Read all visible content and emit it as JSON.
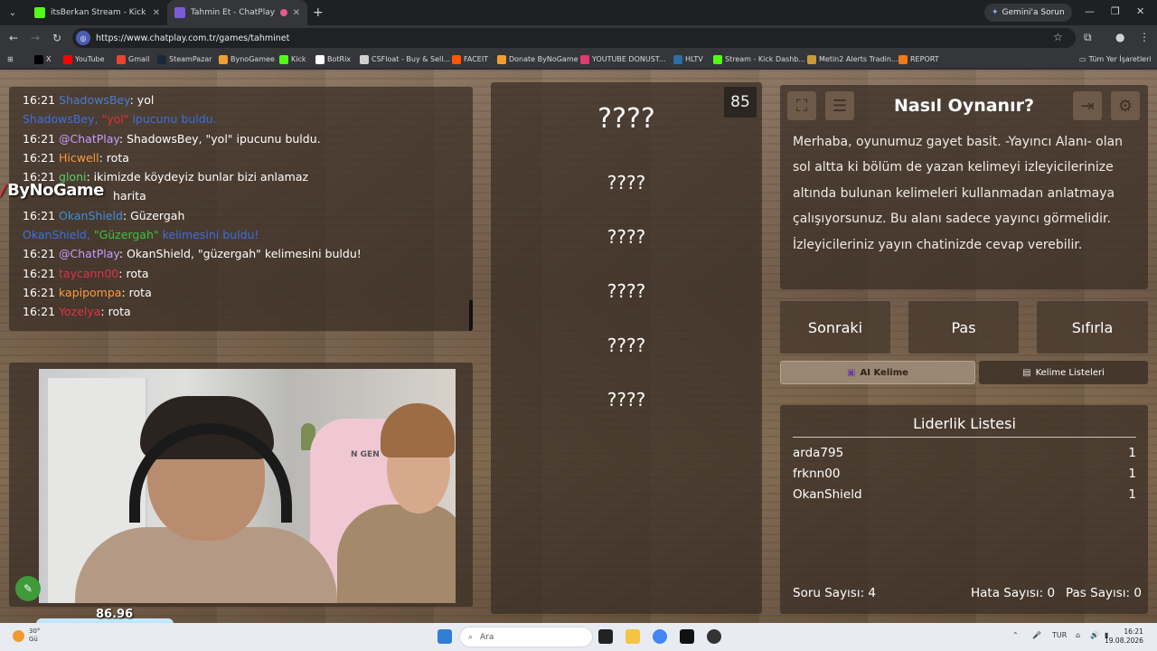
{
  "browser": {
    "tabs": [
      {
        "title": "itsBerkan Stream - Kick Dashbo",
        "favicon_color": "#53fc18"
      },
      {
        "title": "Tahmin Et - ChatPlay",
        "favicon_color": "#7b5cd6"
      }
    ],
    "gemini_label": "Gemini'a Sorun",
    "url": "https://www.chatplay.com.tr/games/tahminet",
    "bookmarks": [
      "X",
      "YouTube",
      "Gmail",
      "SteamPazar",
      "BynoGamee",
      "Kick",
      "BotRix",
      "CSFloat - Buy & Sell...",
      "FACEIT",
      "Donate ByNoGame",
      "YOUTUBE DONUST...",
      "HLTV",
      "Stream - Kick Dashb...",
      "Metin2 Alerts Tradin...",
      "REPORT"
    ],
    "all_bookmarks": "Tüm Yer İşaretleri"
  },
  "chat": {
    "messages": [
      {
        "time": "16:21",
        "user": "ShadowsBey",
        "user_color": "#4a7bd8",
        "text": ": yol"
      },
      {
        "time": "",
        "user": "ShadowsBey, ",
        "user_color": "#3d6fe0",
        "highlight": "\"yol\"",
        "highlight_color": "#e03030",
        "text": " ipucunu buldu.",
        "text_color": "#3d6fe0"
      },
      {
        "time": "16:21",
        "user": "@ChatPlay",
        "user_color": "#c79cff",
        "text": ": ShadowsBey, \"yol\" ipucunu buldu."
      },
      {
        "time": "16:21",
        "user": "Hicwell",
        "user_color": "#ff9b3b",
        "text": ": rota"
      },
      {
        "time": "16:21",
        "user": "gloni",
        "user_color": "#58d06c",
        "text": ": ikimizde köydeyiz bunlar bizi anlamaz"
      },
      {
        "time": "",
        "user": "",
        "user_color": "#ffffff",
        "text": "harita"
      },
      {
        "time": "16:21",
        "user": "OkanShield",
        "user_color": "#3d8fe0",
        "text": ": Güzergah"
      },
      {
        "time": "",
        "user": "OkanShield, ",
        "user_color": "#3d6fe0",
        "highlight": "\"Güzergah\"",
        "highlight_color": "#3cc43c",
        "text": " kelimesini buldu!",
        "text_color": "#3d6fe0"
      },
      {
        "time": "16:21",
        "user": "@ChatPlay",
        "user_color": "#c79cff",
        "text": ": OkanShield, \"güzergah\" kelimesini buldu!"
      },
      {
        "time": "16:21",
        "user": "taycann00",
        "user_color": "#e0314a",
        "text": ": rota"
      },
      {
        "time": "16:21",
        "user": "kapipompa",
        "user_color": "#ff9b3b",
        "text": ": rota"
      },
      {
        "time": "16:21",
        "user": "Yozelya",
        "user_color": "#e0314a",
        "text": ": rota"
      }
    ]
  },
  "overlay": {
    "brand": "ByNoGame",
    "counter": "86.96"
  },
  "webcam": {
    "chair_label": "N GEN"
  },
  "game": {
    "score": "85",
    "words": [
      "????",
      "????",
      "????",
      "????",
      "????",
      "????"
    ]
  },
  "howto": {
    "title": "Nasıl Oynanır?",
    "text": "Merhaba, oyunumuz gayet basit. -Yayıncı Alanı- olan sol altta ki bölüm de yazan kelimeyi izleyicilerinize altında bulunan kelimeleri kullanmadan anlatmaya çalışıyorsunuz. Bu alanı sadece yayıncı görmelidir. İzleyicileriniz yayın chatinizde cevap verebilir."
  },
  "controls": {
    "next": "Sonraki",
    "pass": "Pas",
    "reset": "Sıfırla",
    "ai_word": "AI Kelime",
    "word_lists": "Kelime Listeleri"
  },
  "leaderboard": {
    "title": "Liderlik Listesi",
    "rows": [
      {
        "name": "arda795",
        "score": "1"
      },
      {
        "name": "frknn00",
        "score": "1"
      },
      {
        "name": "OkanShield",
        "score": "1"
      }
    ]
  },
  "stats": {
    "questions": "Soru Sayısı: 4",
    "errors": "Hata Sayısı: 0",
    "passes": "Pas Sayısı: 0"
  },
  "taskbar": {
    "weather_temp": "30°",
    "weather_sub": "Gü",
    "search_placeholder": "Ara",
    "language": "TUR",
    "time": "16:21",
    "date": "19.08.2026"
  }
}
